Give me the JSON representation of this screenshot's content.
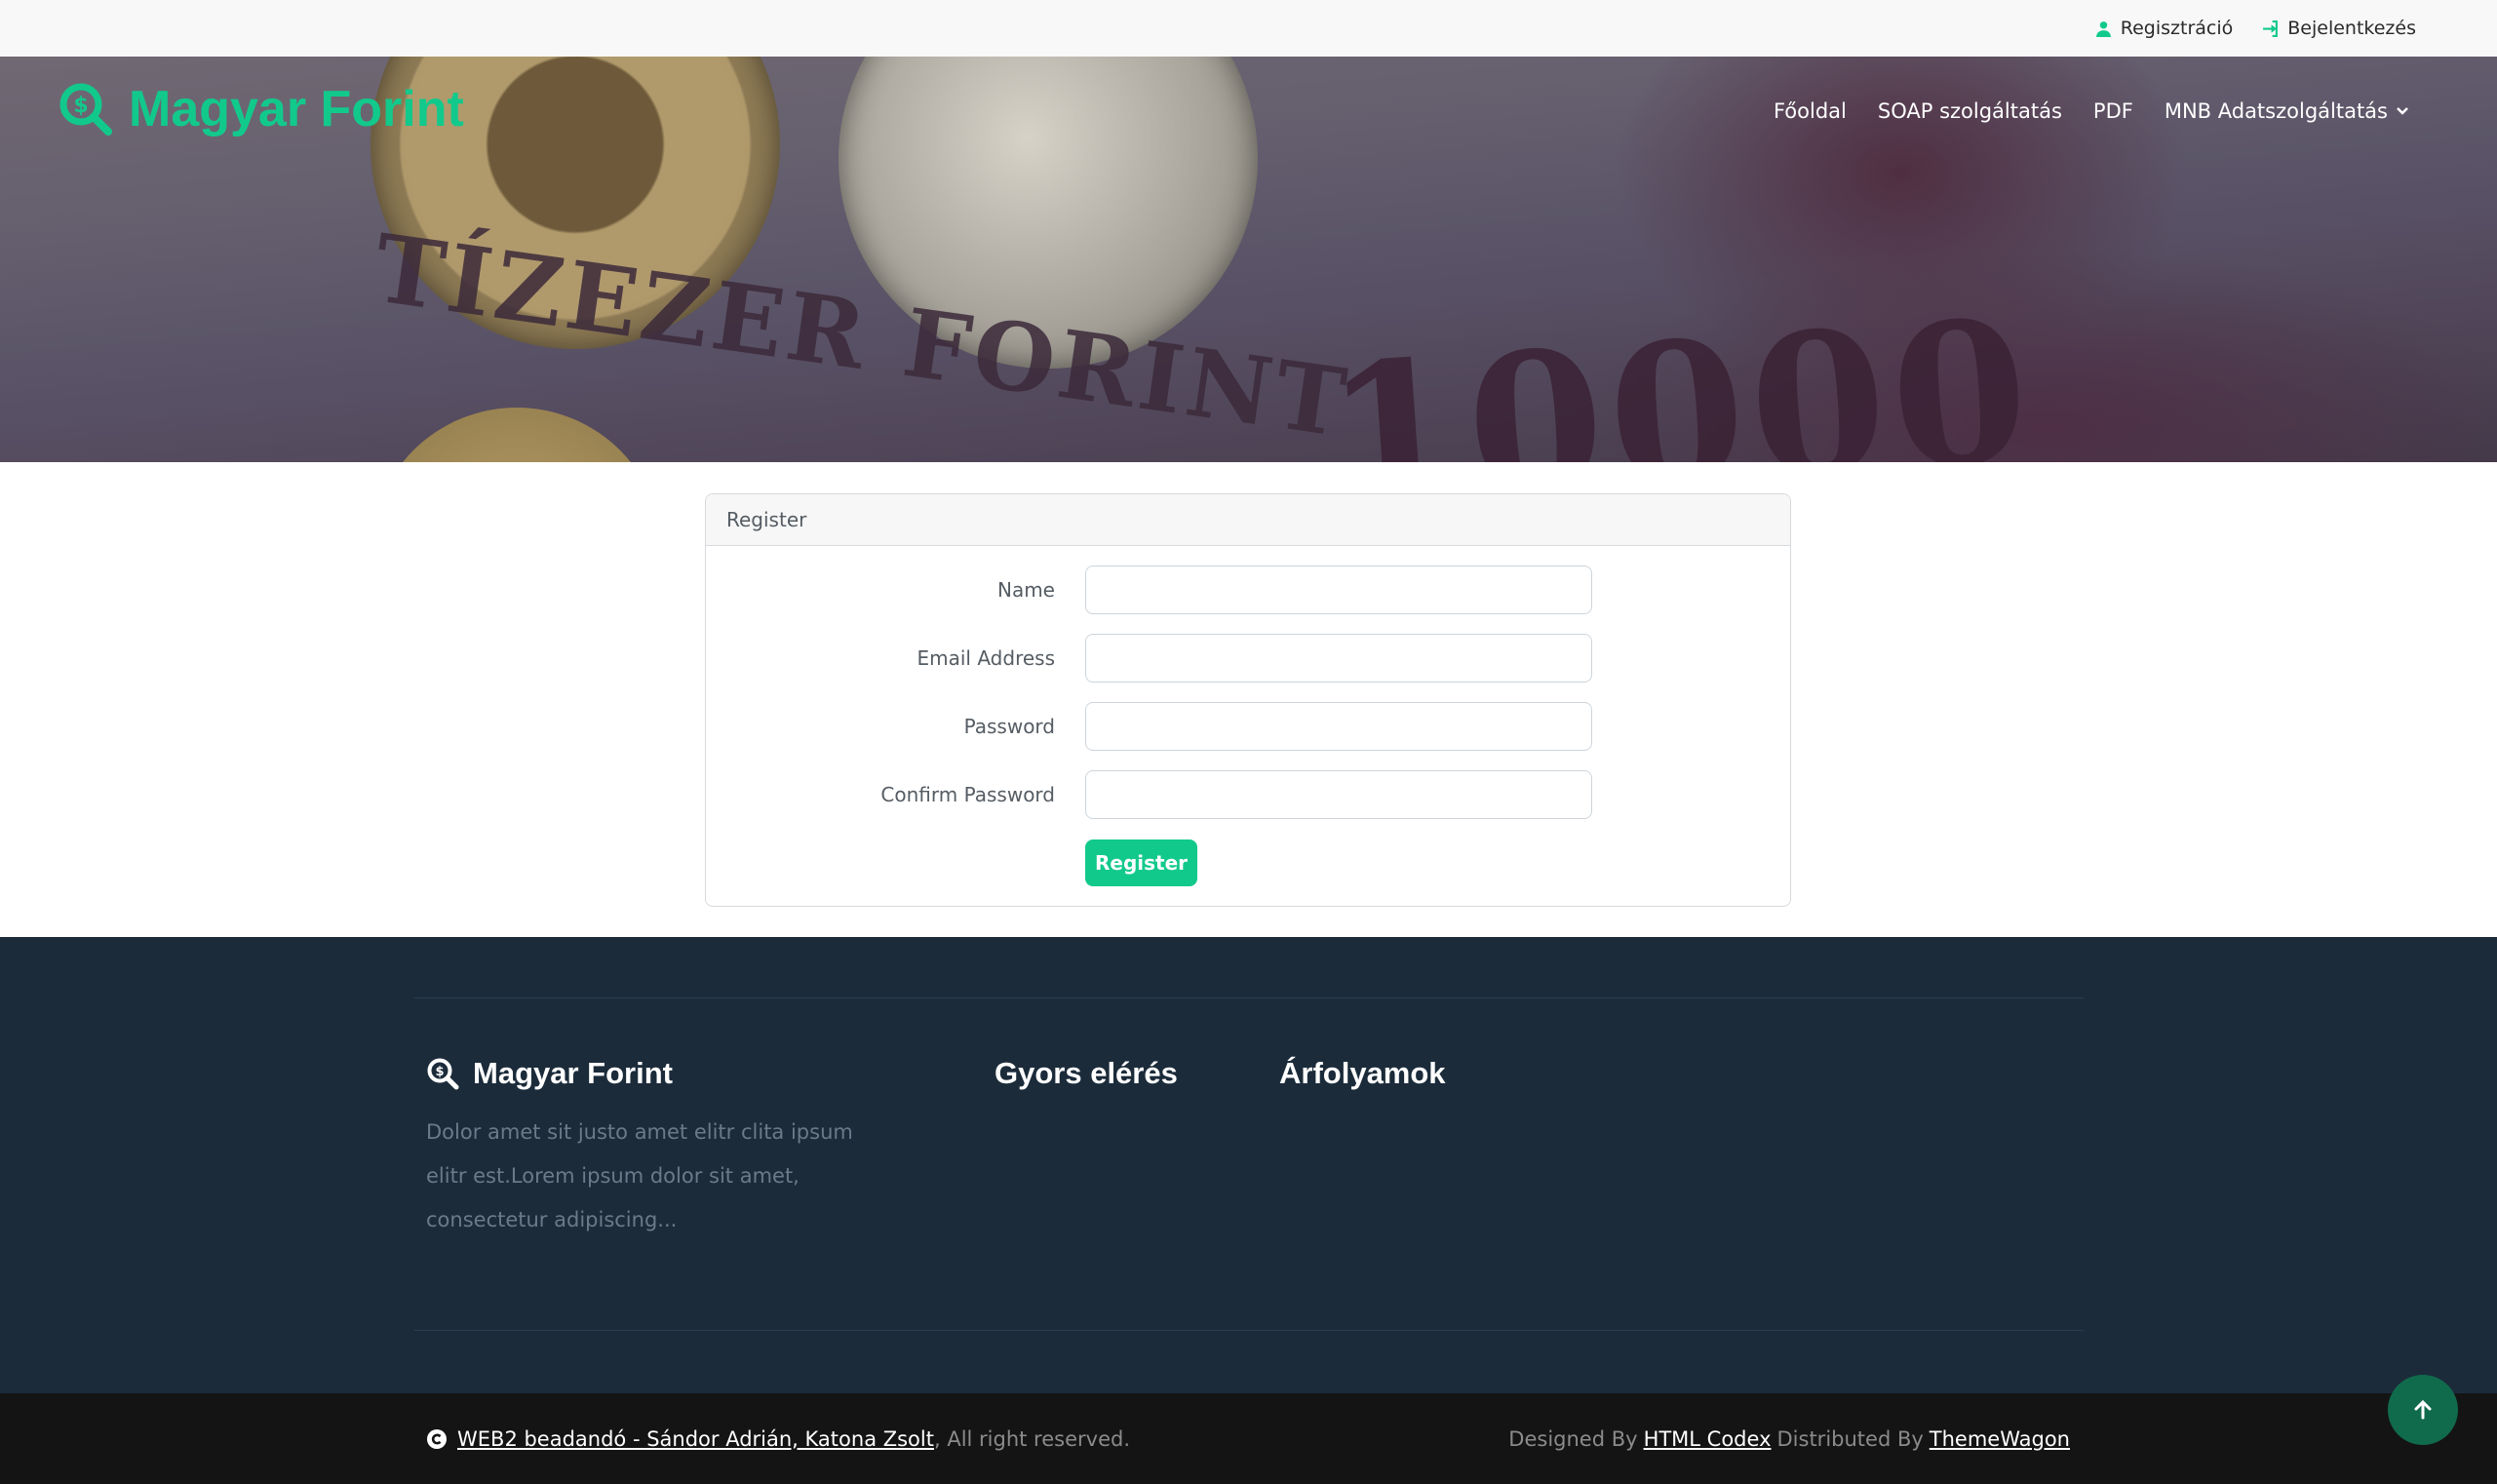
{
  "topbar": {
    "register_label": "Regisztráció",
    "login_label": "Bejelentkezés"
  },
  "brand": {
    "name": "Magyar Forint"
  },
  "nav": {
    "items": [
      "Főoldal",
      "SOAP szolgáltatás",
      "PDF",
      "MNB Adatszolgáltatás"
    ]
  },
  "hero": {
    "bill_text": "TÍZEZER FORINT",
    "bill_number": "10000"
  },
  "register_card": {
    "title": "Register",
    "fields": [
      {
        "label": "Name",
        "value": "",
        "placeholder": ""
      },
      {
        "label": "Email Address",
        "value": "",
        "placeholder": ""
      },
      {
        "label": "Password",
        "value": "",
        "placeholder": ""
      },
      {
        "label": "Confirm Password",
        "value": "",
        "placeholder": ""
      }
    ],
    "submit_label": "Register"
  },
  "footer": {
    "brand": "Magyar Forint",
    "description": "Dolor amet sit justo amet elitr clita ipsum elitr est.Lorem ipsum dolor sit amet, consectetur adipiscing...",
    "col2_title": "Gyors elérés",
    "col3_title": "Árfolyamok"
  },
  "bottombar": {
    "copyright_link": "WEB2 beadandó - Sándor Adrián, Katona Zsolt",
    "copyright_suffix": ", All right reserved.",
    "designed_by": "Designed By",
    "designer": "HTML Codex",
    "distributed_by": "Distributed By",
    "distributor": "ThemeWagon"
  },
  "colors": {
    "accent": "#12c98c",
    "footer_bg": "#1b2b3a",
    "bottombar_bg": "#141414"
  },
  "icons": [
    "user-icon",
    "sign-in-icon",
    "search-dollar-icon",
    "chevron-down-icon",
    "copyright-icon",
    "arrow-up-icon"
  ]
}
